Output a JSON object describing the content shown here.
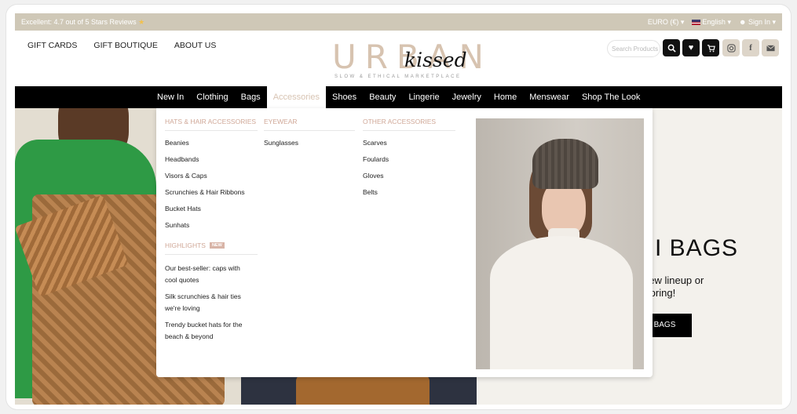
{
  "topbar": {
    "review": "Excellent: 4.7 out of 5 Stars Reviews",
    "currency": "EURO (€) ▾",
    "language": "English ▾",
    "signin": "Sign In ▾"
  },
  "header": {
    "links": [
      "GIFT CARDS",
      "GIFT BOUTIQUE",
      "ABOUT US"
    ],
    "logo_main": "URBAN",
    "logo_script": "kissed",
    "tagline": "SLOW & ETHICAL MARKETPLACE",
    "search_placeholder": "Search Products"
  },
  "icons": {
    "search": "search-icon",
    "wishlist": "heart-icon",
    "cart": "cart-icon",
    "instagram": "instagram-icon",
    "facebook": "facebook-icon",
    "email": "email-icon"
  },
  "nav": {
    "items": [
      "New In",
      "Clothing",
      "Bags",
      "Accessories",
      "Shoes",
      "Beauty",
      "Lingerie",
      "Jewelry",
      "Home",
      "Menswear",
      "Shop The Look"
    ],
    "active": "Accessories"
  },
  "megamenu": {
    "hats": {
      "heading": "HATS & HAIR ACCESSORIES",
      "items": [
        "Beanies",
        "Headbands",
        "Visors & Caps",
        "Scrunchies & Hair Ribbons",
        "Bucket Hats",
        "Sunhats"
      ]
    },
    "eyewear": {
      "heading": "EYEWEAR",
      "items": [
        "Sunglasses"
      ]
    },
    "other": {
      "heading": "OTHER ACCESSORIES",
      "items": [
        "Scarves",
        "Foulards",
        "Gloves",
        "Belts"
      ]
    },
    "highlights": {
      "heading": "HIGHLIGHTS",
      "badge": "NEW",
      "items": [
        "Our best-seller: caps with cool quotes",
        "Silk scrunchies & hair ties we're loving",
        "Trendy bucket hats for the beach & beyond"
      ]
    }
  },
  "hero": {
    "title": "I BAGS",
    "subtitle": "new lineup or Spring!",
    "button": "BAGS"
  },
  "colors": {
    "topbar": "#cfc8b7",
    "accent": "#d0a898",
    "nav": "#000000",
    "logo": "#d7c3b0"
  }
}
